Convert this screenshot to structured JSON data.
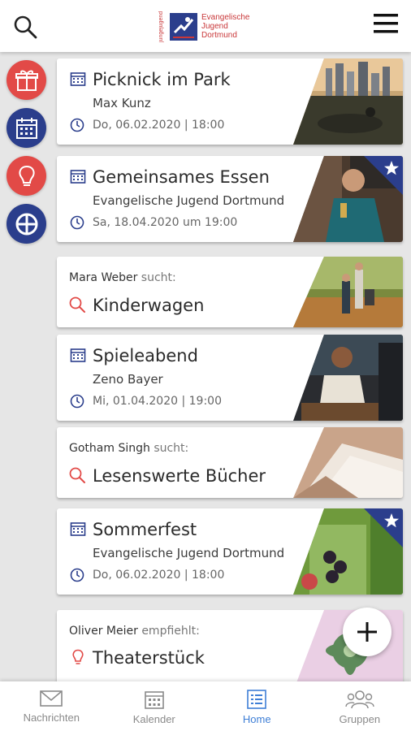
{
  "header": {
    "logo_vertical": "jungejugend",
    "logo_text": [
      "Evangelische",
      "Jugend",
      "Dortmund"
    ]
  },
  "rail": {
    "items": [
      "gift-icon",
      "calendar-icon",
      "lightbulb-icon",
      "lifebuoy-icon"
    ]
  },
  "cards": [
    {
      "title": "Picknick im Park",
      "organizer": "Max Kunz",
      "date": "Do, 06.02.2020 | 18:00"
    },
    {
      "title": "Gemeinsames Essen",
      "organizer": "Evangelische Jugend Dortmund",
      "date": "Sa, 18.04.2020 um 19:00",
      "starred": true
    },
    {
      "who": "Mara Weber",
      "verb": "sucht:",
      "title": "Kinderwagen"
    },
    {
      "title": "Spieleabend",
      "organizer": "Zeno Bayer",
      "date": "Mi, 01.04.2020 | 19:00"
    },
    {
      "who": "Gotham Singh",
      "verb": "sucht:",
      "title": "Lesenswerte Bücher"
    },
    {
      "title": "Sommerfest",
      "organizer": "Evangelische Jugend Dortmund",
      "date": "Do, 06.02.2020 | 18:00",
      "starred": true
    },
    {
      "who": "Oliver Meier",
      "verb": "empfiehlt:",
      "title": "Theaterstück"
    }
  ],
  "fab": "+",
  "nav": [
    {
      "label": "Nachrichten",
      "icon": "envelope-icon"
    },
    {
      "label": "Kalender",
      "icon": "calendar-icon"
    },
    {
      "label": "Home",
      "icon": "list-icon",
      "active": true
    },
    {
      "label": "Gruppen",
      "icon": "group-icon"
    }
  ],
  "colors": {
    "accent_red": "#e24a47",
    "accent_blue": "#2b3e8c",
    "active_nav": "#3f7fd6"
  }
}
